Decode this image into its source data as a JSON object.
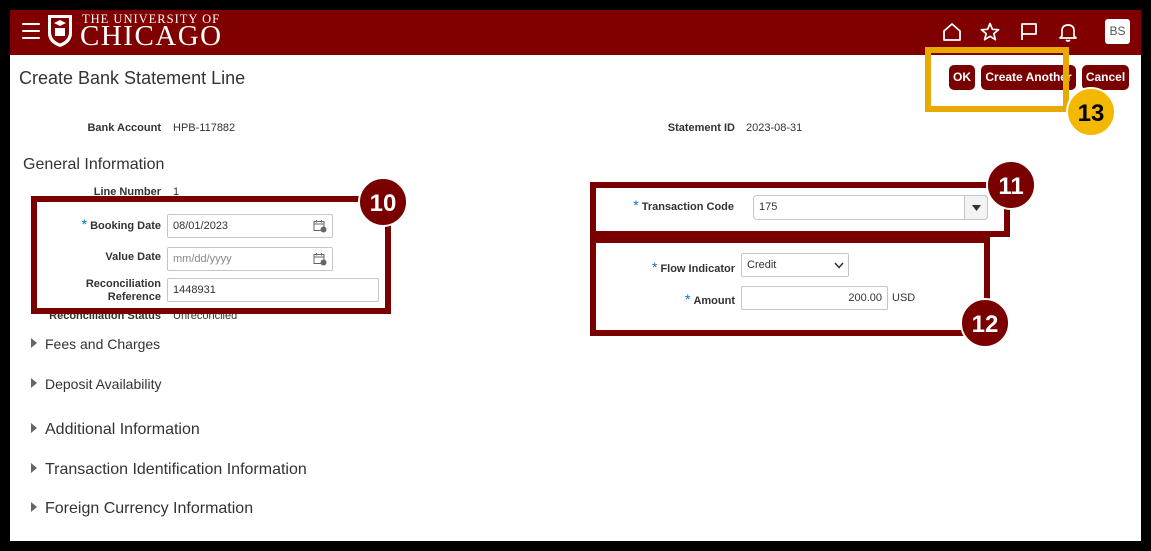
{
  "header": {
    "university_line1": "THE UNIVERSITY OF",
    "university_line2": "CHICAGO",
    "avatar_initials": "BS"
  },
  "page": {
    "title": "Create Bank Statement Line"
  },
  "buttons": {
    "ok": "OK",
    "create_another": "Create Another",
    "cancel": "Cancel"
  },
  "summary": {
    "bank_account_label": "Bank Account",
    "bank_account_value": "HPB-117882",
    "statement_id_label": "Statement ID",
    "statement_id_value": "2023-08-31"
  },
  "general": {
    "section_title": "General Information",
    "line_number_label": "Line Number",
    "line_number_value": "1",
    "booking_date_label": "Booking Date",
    "booking_date_value": "08/01/2023",
    "value_date_label": "Value Date",
    "value_date_placeholder": "mm/dd/yyyy",
    "recon_ref_label_1": "Reconciliation",
    "recon_ref_label_2": "Reference",
    "recon_ref_value": "1448931",
    "recon_status_label": "Reconciliation Status",
    "recon_status_value": "Unreconciled",
    "transaction_code_label": "Transaction Code",
    "transaction_code_value": "175",
    "flow_indicator_label": "Flow Indicator",
    "flow_indicator_value": "Credit",
    "amount_label": "Amount",
    "amount_value": "200.00",
    "amount_currency": "USD",
    "required_mark": "*"
  },
  "sections": [
    "Fees and Charges",
    "Deposit Availability",
    "Additional Information",
    "Transaction Identification Information",
    "Foreign Currency Information"
  ],
  "callouts": {
    "c10": "10",
    "c11": "11",
    "c12": "12",
    "c13": "13"
  },
  "colors": {
    "brand": "#800000",
    "button": "#7a0000",
    "highlight": "#e8a900",
    "required": "#0572ce"
  },
  "icons": [
    "menu-icon",
    "home-icon",
    "star-icon",
    "flag-icon",
    "bell-icon",
    "calendar-icon",
    "chevron-down-icon",
    "triangle-right-icon"
  ]
}
